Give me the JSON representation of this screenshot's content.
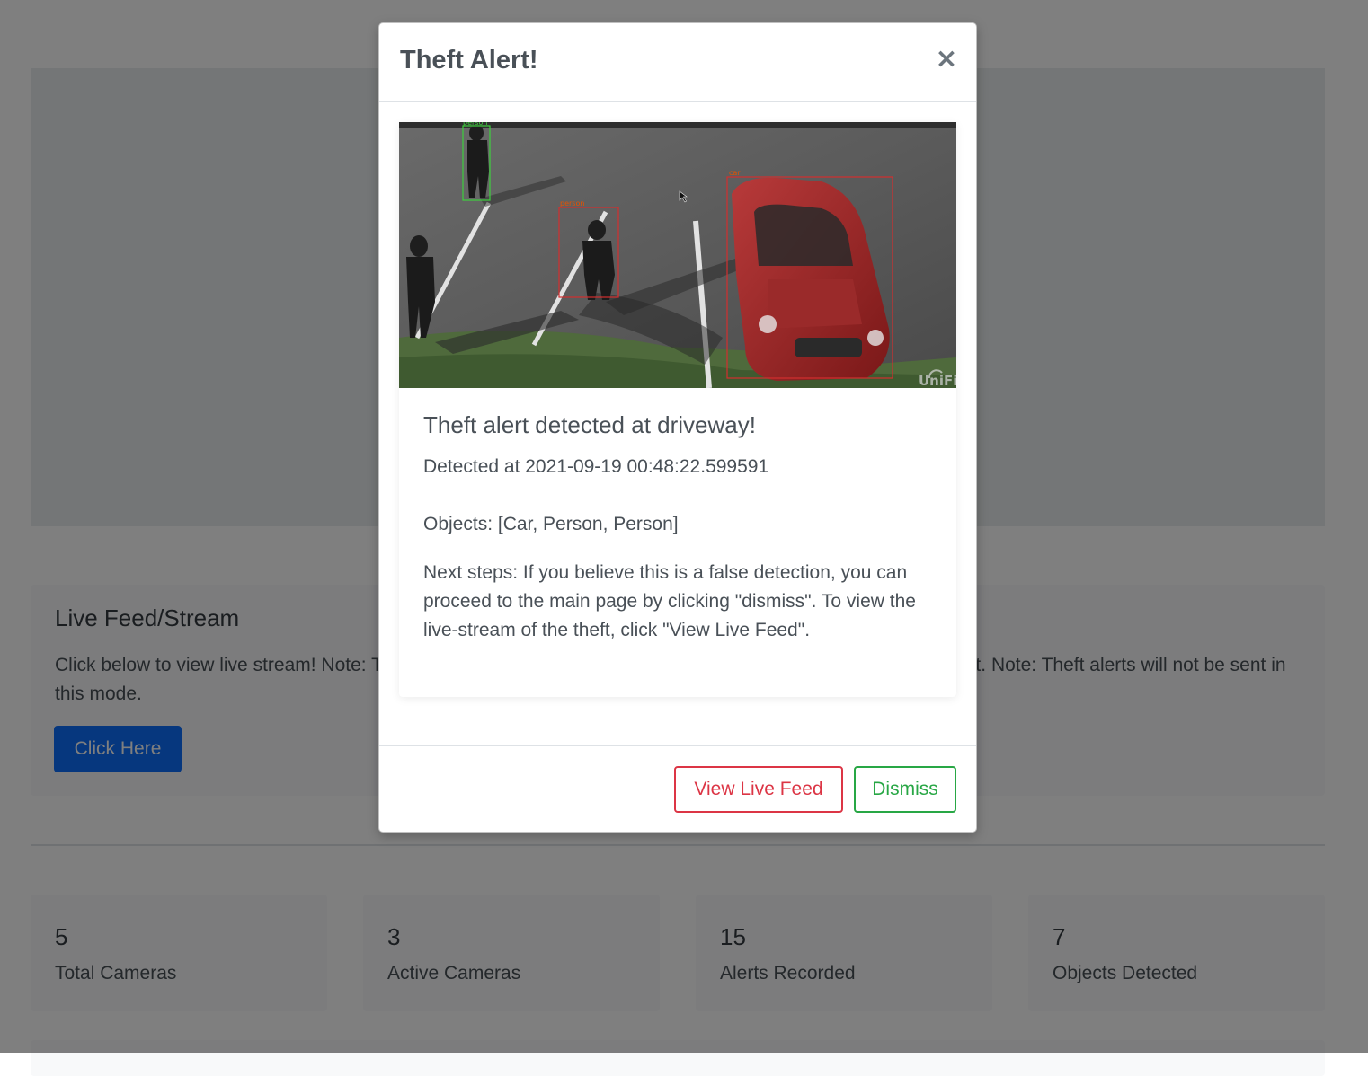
{
  "background": {
    "live_feed": {
      "title": "Live Feed/Stream",
      "text": "Click below to view live stream! Note: This page may open due to an active theft alert or when clicking this alert. Note: Theft alerts will not be sent in this mode.",
      "button_label": "Click Here"
    },
    "stats": [
      {
        "value": "5",
        "label": "Total Cameras"
      },
      {
        "value": "3",
        "label": "Active Cameras"
      },
      {
        "value": "15",
        "label": "Alerts Recorded"
      },
      {
        "value": "7",
        "label": "Objects Detected"
      }
    ]
  },
  "modal": {
    "title": "Theft Alert!",
    "close_label": "×",
    "card": {
      "title": "Theft alert detected at driveway!",
      "detected": "Detected at 2021-09-19 00:48:22.599591",
      "objects": "Objects: [Car, Person, Person]",
      "next_steps": "Next steps: If you believe this is a false detection, you can proceed to the main page by clicking \"dismiss\". To view the live-stream of the theft, click \"View Live Feed\"."
    },
    "image": {
      "labels": [
        "person",
        "person",
        "car"
      ],
      "watermark": "UniFi"
    },
    "footer": {
      "view_label": "View Live Feed",
      "dismiss_label": "Dismiss"
    }
  },
  "colors": {
    "primary": "#0d6efd",
    "danger": "#dc3545",
    "success": "#28a745",
    "box_green": "#3ecf3e",
    "box_red": "#d32f2f"
  }
}
